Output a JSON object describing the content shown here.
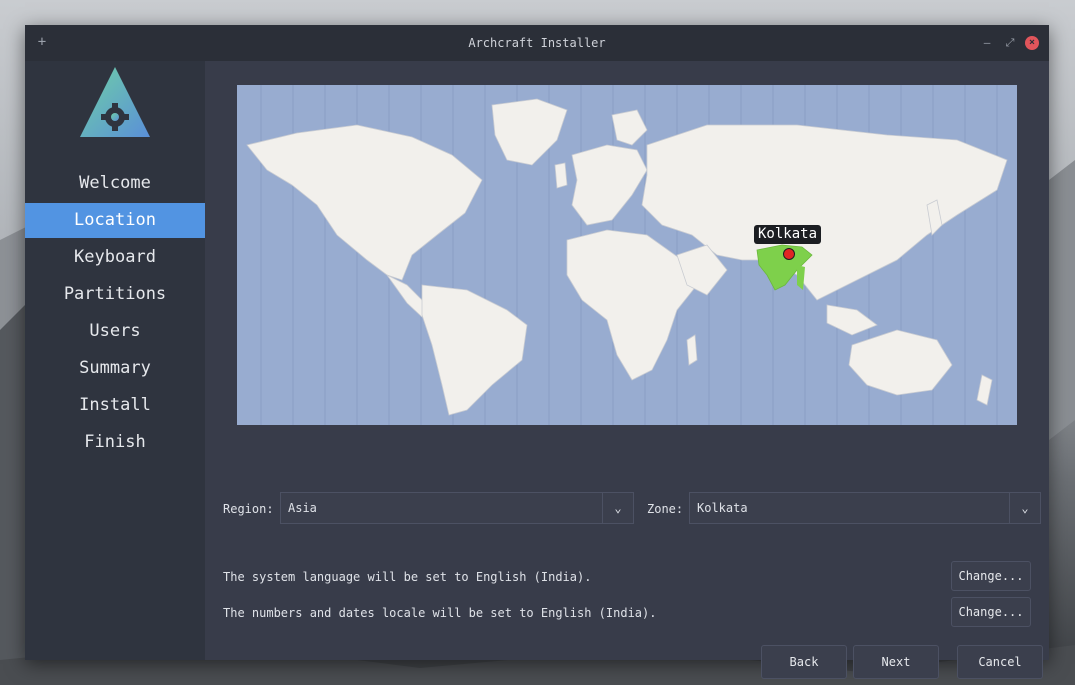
{
  "window": {
    "title": "Archcraft Installer"
  },
  "sidebar": {
    "items": [
      {
        "label": "Welcome",
        "active": false
      },
      {
        "label": "Location",
        "active": true
      },
      {
        "label": "Keyboard",
        "active": false
      },
      {
        "label": "Partitions",
        "active": false
      },
      {
        "label": "Users",
        "active": false
      },
      {
        "label": "Summary",
        "active": false
      },
      {
        "label": "Install",
        "active": false
      },
      {
        "label": "Finish",
        "active": false
      }
    ]
  },
  "map": {
    "selected_city": "Kolkata",
    "highlight_color": "#7ed04b",
    "water_color": "#98acd0",
    "land_color": "#f2f0ec"
  },
  "location": {
    "region_label": "Region:",
    "region_value": "Asia",
    "zone_label": "Zone:",
    "zone_value": "Kolkata"
  },
  "locale": {
    "language_text": "The system language will be set to English (India).",
    "numbers_text": "The numbers and dates locale will be set to English (India).",
    "change_label": "Change..."
  },
  "footer": {
    "back_label": "Back",
    "next_label": "Next",
    "cancel_label": "Cancel"
  },
  "colors": {
    "accent": "#5294e2",
    "window_bg": "#2f343f",
    "panel_bg": "#383c4a"
  }
}
